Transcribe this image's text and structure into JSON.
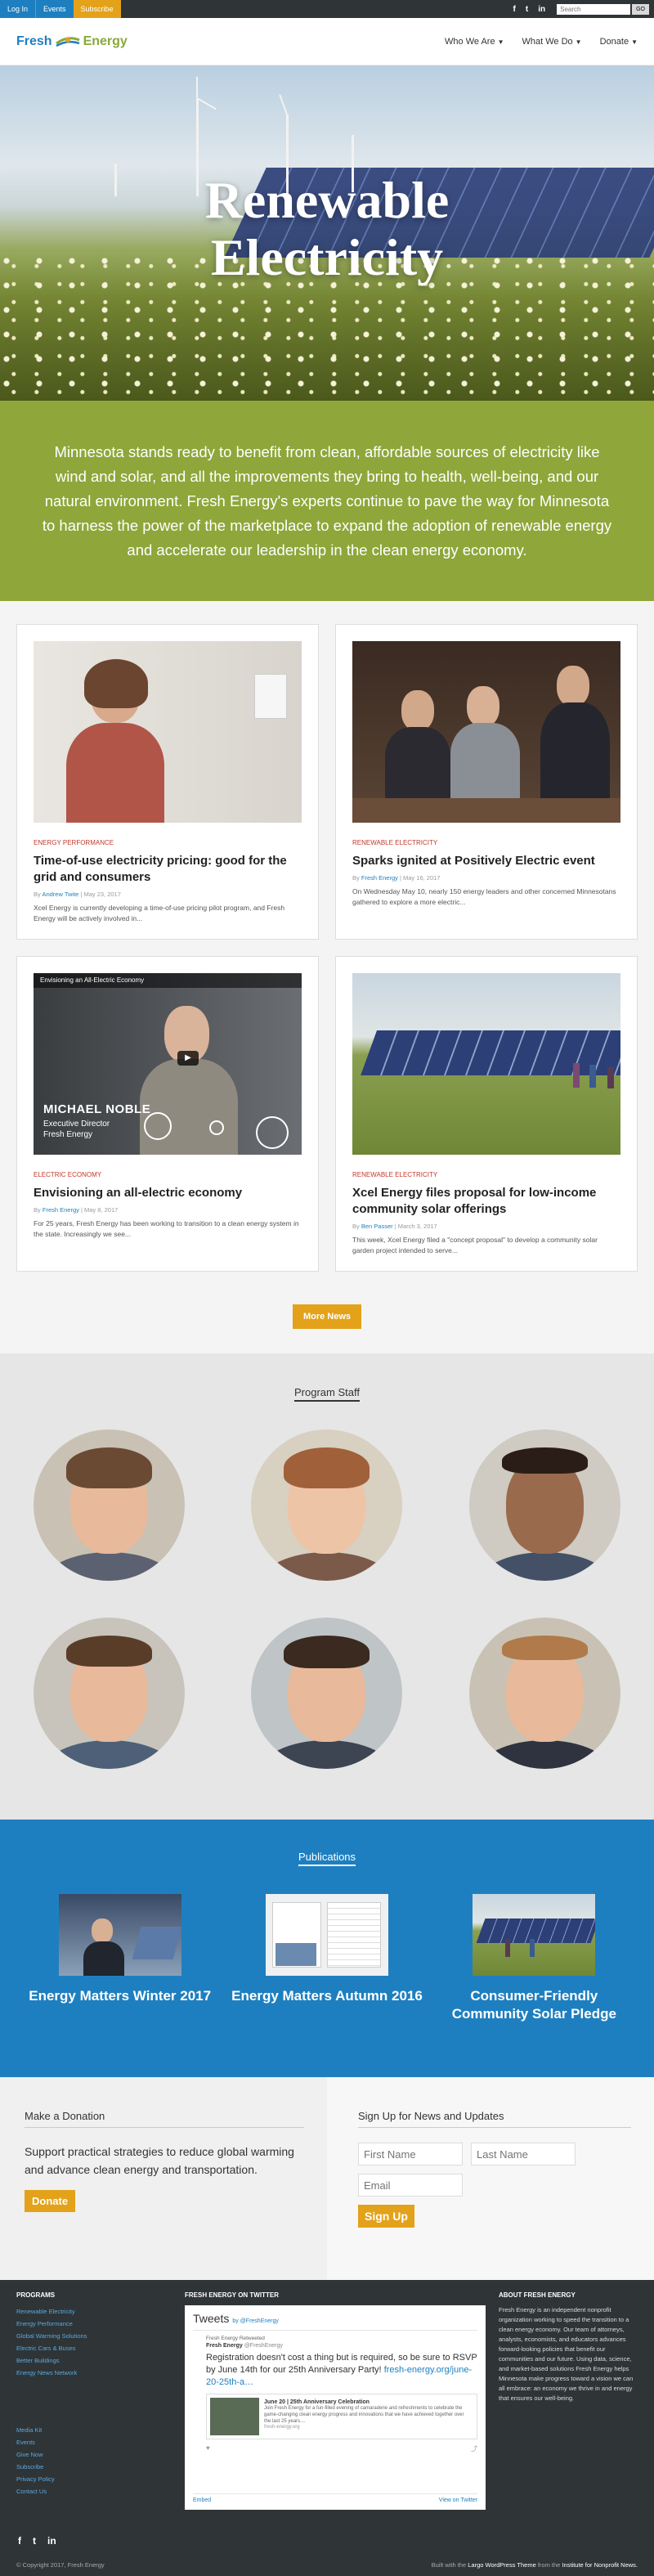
{
  "utility": {
    "login": "Log In",
    "events": "Events",
    "subscribe": "Subscribe",
    "social": [
      "f",
      "t",
      "in"
    ],
    "search_placeholder": "Search",
    "go": "GO"
  },
  "header": {
    "logo_left": "Fresh",
    "logo_right": "Energy",
    "nav": [
      "Who We Are",
      "What We Do",
      "Donate"
    ]
  },
  "hero": {
    "title_line1": "Renewable",
    "title_line2": "Electricity"
  },
  "intro": "Minnesota stands ready to benefit from clean, affordable sources of electricity like wind and solar, and all the improvements they bring to health, well-being, and our natural environment. Fresh Energy's experts continue to pave the way for Minnesota to harness the power of the marketplace to expand the adoption of renewable energy and accelerate our leadership in the clean energy economy.",
  "articles": [
    {
      "category": "Energy Performance",
      "title": "Time-of-use electricity pricing: good for the grid and consumers",
      "by": "By",
      "author": "Andrew Twite",
      "date": "May 23, 2017",
      "excerpt": "Xcel Energy is currently developing a time-of-use pricing pilot program, and Fresh Energy will be actively involved in..."
    },
    {
      "category": "Renewable Electricity",
      "title": "Sparks ignited at Positively Electric event",
      "by": "By",
      "author": "Fresh Energy",
      "date": "May 16, 2017",
      "excerpt": "On Wednesday May 10, nearly 150 energy leaders and other concerned Minnesotans gathered to explore a more electric..."
    },
    {
      "category": "Electric Economy",
      "title": "Envisioning an all-electric economy",
      "by": "By",
      "author": "Fresh Energy",
      "date": "May 8, 2017",
      "excerpt": "For 25 years, Fresh Energy has been working to transition to a clean energy system in the state. Increasingly we see...",
      "video_title": "Envisioning an All-Electric Economy",
      "video_name": "MICHAEL NOBLE",
      "video_role1": "Executive Director",
      "video_role2": "Fresh Energy"
    },
    {
      "category": "Renewable Electricity",
      "title": "Xcel Energy files proposal for low-income community solar offerings",
      "by": "By",
      "author": "Ben Passer",
      "date": "March 3, 2017",
      "excerpt": "This week, Xcel Energy filed a \"concept proposal\" to develop a community solar garden project intended to serve..."
    }
  ],
  "more_news": "More News",
  "staff": {
    "heading": "Program Staff"
  },
  "publications": {
    "heading": "Publications",
    "items": [
      "Energy Matters Winter 2017",
      "Energy Matters Autumn 2016",
      "Consumer-Friendly Community Solar Pledge"
    ]
  },
  "donate": {
    "heading": "Make a Donation",
    "text": "Support practical strategies to reduce global warming and advance clean energy and transportation.",
    "button": "Donate"
  },
  "signup": {
    "heading": "Sign Up for News and Updates",
    "first": "First Name",
    "last": "Last Name",
    "email": "Email",
    "button": "Sign Up"
  },
  "footer": {
    "programs_h": "Programs",
    "programs": [
      "Renewable Electricity",
      "Energy Performance",
      "Global Warming Solutions",
      "Electric Cars & Buses",
      "Better Buildings",
      "Energy News Network"
    ],
    "links": [
      "Media Kit",
      "Events",
      "Give Now",
      "Subscribe",
      "Privacy Policy",
      "Contact Us"
    ],
    "twitter_h": "Fresh Energy on Twitter",
    "tweets": "Tweets",
    "tweets_by": "by @FreshEnergy",
    "retweeted": "Fresh Energy Retweeted",
    "tw_author": "Fresh Energy",
    "tw_handle": "@FreshEnergy",
    "tw_text": "Registration doesn't cost a thing but is required, so be sure to RSVP by June 14th for our 25th Anniversary Party!",
    "tw_link": "fresh-energy.org/june-20-25th-a…",
    "tw_card_title": "June 20 | 25th Anniversary Celebration",
    "tw_card_desc": "Join Fresh Energy for a fun-filled evening of camaraderie and refreshments to celebrate the game-changing clean energy progress and innovations that we have achieved together over the last 25 years....",
    "tw_card_url": "fresh-energy.org",
    "tw_embed": "Embed",
    "tw_view": "View on Twitter",
    "about_h": "About Fresh Energy",
    "about": "Fresh Energy is an independent nonprofit organization working to speed the transition to a clean energy economy. Our team of attorneys, analysts, economists, and educators advances forward-looking policies that benefit our communities and our future. Using data, science, and market-based solutions Fresh Energy helps Minnesota make progress toward a vision we can all embrace: an economy we thrive in and energy that ensures our well-being.",
    "social": [
      "f",
      "t",
      "in"
    ],
    "copyright": "© Copyright 2017, Fresh Energy",
    "built_a": "Built with the",
    "built_b": "Largo WordPress Theme",
    "built_c": "from the",
    "built_d": "Institute for Nonprofit News."
  },
  "colors": {
    "blue": "#1e7fc0",
    "green": "#8fa63a",
    "yellow": "#e3a21a",
    "dark": "#2f3437",
    "red": "#c0392b"
  }
}
